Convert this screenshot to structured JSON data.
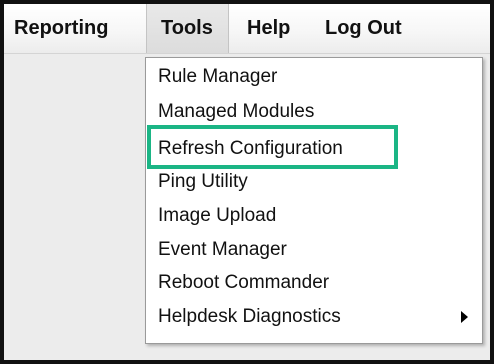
{
  "menubar": {
    "items": [
      {
        "label": "Reporting"
      },
      {
        "label": "Tools"
      },
      {
        "label": "Help"
      },
      {
        "label": "Log Out"
      }
    ]
  },
  "dropdown": {
    "parent": "Tools",
    "items": [
      {
        "label": "Rule Manager"
      },
      {
        "label": "Managed Modules"
      },
      {
        "label": "Refresh Configuration",
        "highlighted": true
      },
      {
        "label": "Ping Utility"
      },
      {
        "label": "Image Upload"
      },
      {
        "label": "Event Manager"
      },
      {
        "label": "Reboot Commander"
      },
      {
        "label": "Helpdesk Diagnostics",
        "has_submenu": true
      }
    ]
  },
  "colors": {
    "highlight_border": "#1bb585",
    "frame_border": "#111111",
    "app_background": "#ececec"
  }
}
